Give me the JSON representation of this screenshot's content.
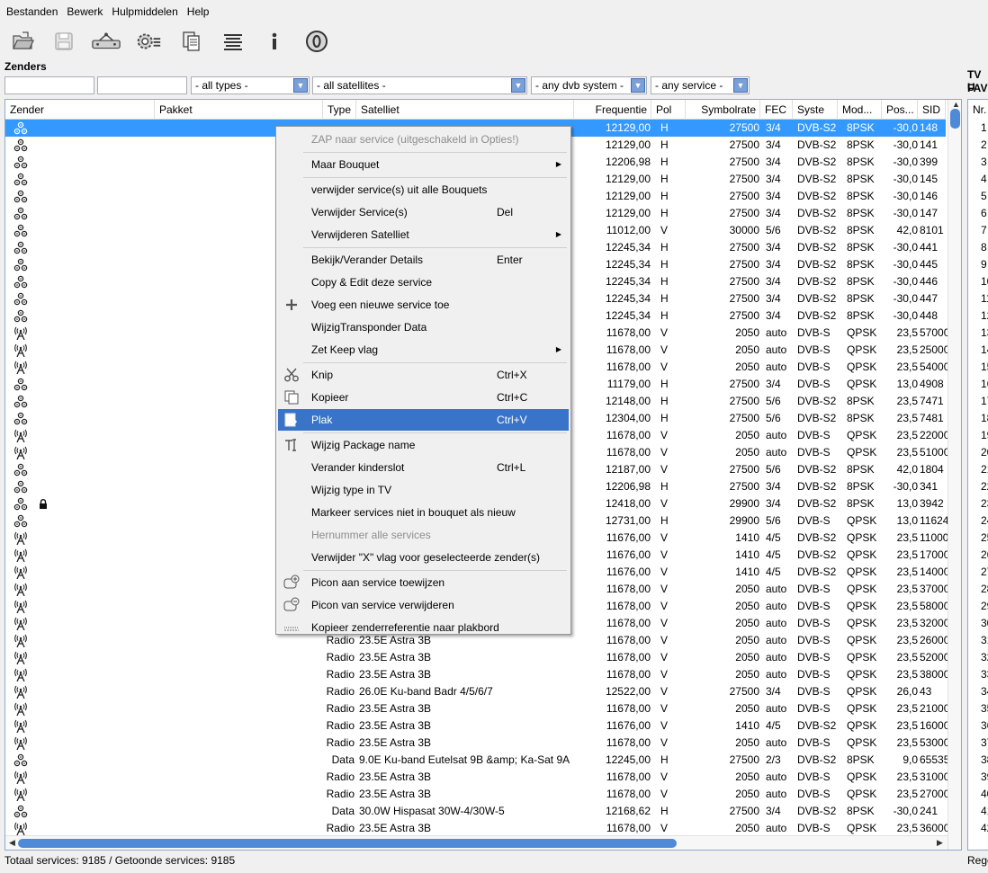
{
  "menubar": [
    "Bestanden",
    "Bewerk",
    "Hulpmiddelen",
    "Help"
  ],
  "toolbar_icons": [
    "open-folder-icon",
    "save-icon",
    "satellite-dish-icon",
    "settings-gear-icon",
    "copy-document-icon",
    "list-lines-icon",
    "info-icon",
    "zero-circle-icon"
  ],
  "section_title": "Zenders",
  "filters": {
    "types": "- all types -",
    "satellites": "- all satellites -",
    "dvb": "- any dvb system -",
    "service": "- any service -"
  },
  "side_labels": [
    "TV U",
    "FAVO"
  ],
  "columns": [
    "Zender",
    "Pakket",
    "Type",
    "Satelliet",
    "Frequentie",
    "Pol",
    "Symbolrate",
    "FEC",
    "Syste",
    "Mod...",
    "Pos...",
    "SID"
  ],
  "right_header": "Nr.",
  "rows": [
    {
      "icon": "tv",
      "type": "",
      "sat": "",
      "freq": "12129,00",
      "pol": "H",
      "sr": "27500",
      "fec": "3/4",
      "sys": "DVB-S2",
      "mod": "8PSK",
      "pos": "-30,0",
      "sid": "148",
      "sel": true
    },
    {
      "icon": "tv",
      "type": "",
      "sat": "",
      "freq": "12129,00",
      "pol": "H",
      "sr": "27500",
      "fec": "3/4",
      "sys": "DVB-S2",
      "mod": "8PSK",
      "pos": "-30,0",
      "sid": "141"
    },
    {
      "icon": "tv",
      "type": "",
      "sat": "",
      "freq": "12206,98",
      "pol": "H",
      "sr": "27500",
      "fec": "3/4",
      "sys": "DVB-S2",
      "mod": "8PSK",
      "pos": "-30,0",
      "sid": "399"
    },
    {
      "icon": "tv",
      "type": "",
      "sat": "",
      "freq": "12129,00",
      "pol": "H",
      "sr": "27500",
      "fec": "3/4",
      "sys": "DVB-S2",
      "mod": "8PSK",
      "pos": "-30,0",
      "sid": "145"
    },
    {
      "icon": "tv",
      "type": "",
      "sat": "",
      "freq": "12129,00",
      "pol": "H",
      "sr": "27500",
      "fec": "3/4",
      "sys": "DVB-S2",
      "mod": "8PSK",
      "pos": "-30,0",
      "sid": "146"
    },
    {
      "icon": "tv",
      "type": "",
      "sat": "",
      "freq": "12129,00",
      "pol": "H",
      "sr": "27500",
      "fec": "3/4",
      "sys": "DVB-S2",
      "mod": "8PSK",
      "pos": "-30,0",
      "sid": "147"
    },
    {
      "icon": "tv",
      "type": "",
      "sat": "",
      "freq": "11012,00",
      "pol": "V",
      "sr": "30000",
      "fec": "5/6",
      "sys": "DVB-S2",
      "mod": "8PSK",
      "pos": "42,0",
      "sid": "8101"
    },
    {
      "icon": "tv",
      "type": "",
      "sat": "",
      "freq": "12245,34",
      "pol": "H",
      "sr": "27500",
      "fec": "3/4",
      "sys": "DVB-S2",
      "mod": "8PSK",
      "pos": "-30,0",
      "sid": "441"
    },
    {
      "icon": "tv",
      "type": "",
      "sat": "",
      "freq": "12245,34",
      "pol": "H",
      "sr": "27500",
      "fec": "3/4",
      "sys": "DVB-S2",
      "mod": "8PSK",
      "pos": "-30,0",
      "sid": "445"
    },
    {
      "icon": "tv",
      "type": "",
      "sat": "",
      "freq": "12245,34",
      "pol": "H",
      "sr": "27500",
      "fec": "3/4",
      "sys": "DVB-S2",
      "mod": "8PSK",
      "pos": "-30,0",
      "sid": "446"
    },
    {
      "icon": "tv",
      "type": "",
      "sat": "",
      "freq": "12245,34",
      "pol": "H",
      "sr": "27500",
      "fec": "3/4",
      "sys": "DVB-S2",
      "mod": "8PSK",
      "pos": "-30,0",
      "sid": "447"
    },
    {
      "icon": "tv",
      "type": "",
      "sat": "",
      "freq": "12245,34",
      "pol": "H",
      "sr": "27500",
      "fec": "3/4",
      "sys": "DVB-S2",
      "mod": "8PSK",
      "pos": "-30,0",
      "sid": "448"
    },
    {
      "icon": "radio",
      "type": "",
      "sat": "",
      "freq": "11678,00",
      "pol": "V",
      "sr": "2050",
      "fec": "auto",
      "sys": "DVB-S",
      "mod": "QPSK",
      "pos": "23,5",
      "sid": "57000"
    },
    {
      "icon": "radio",
      "type": "",
      "sat": "",
      "freq": "11678,00",
      "pol": "V",
      "sr": "2050",
      "fec": "auto",
      "sys": "DVB-S",
      "mod": "QPSK",
      "pos": "23,5",
      "sid": "25000"
    },
    {
      "icon": "radio",
      "type": "",
      "sat": "",
      "freq": "11678,00",
      "pol": "V",
      "sr": "2050",
      "fec": "auto",
      "sys": "DVB-S",
      "mod": "QPSK",
      "pos": "23,5",
      "sid": "54000"
    },
    {
      "icon": "tv",
      "type": "",
      "sat": "",
      "freq": "11179,00",
      "pol": "H",
      "sr": "27500",
      "fec": "3/4",
      "sys": "DVB-S",
      "mod": "QPSK",
      "pos": "13,0",
      "sid": "4908"
    },
    {
      "icon": "tv",
      "type": "",
      "sat": "",
      "freq": "12148,00",
      "pol": "H",
      "sr": "27500",
      "fec": "5/6",
      "sys": "DVB-S2",
      "mod": "8PSK",
      "pos": "23,5",
      "sid": "7471"
    },
    {
      "icon": "tv",
      "type": "",
      "sat": "",
      "freq": "12304,00",
      "pol": "H",
      "sr": "27500",
      "fec": "5/6",
      "sys": "DVB-S2",
      "mod": "8PSK",
      "pos": "23,5",
      "sid": "7481"
    },
    {
      "icon": "radio",
      "type": "",
      "sat": "",
      "freq": "11678,00",
      "pol": "V",
      "sr": "2050",
      "fec": "auto",
      "sys": "DVB-S",
      "mod": "QPSK",
      "pos": "23,5",
      "sid": "22000"
    },
    {
      "icon": "radio",
      "type": "",
      "sat": "",
      "freq": "11678,00",
      "pol": "V",
      "sr": "2050",
      "fec": "auto",
      "sys": "DVB-S",
      "mod": "QPSK",
      "pos": "23,5",
      "sid": "51000"
    },
    {
      "icon": "tv",
      "type": "",
      "sat": "",
      "freq": "12187,00",
      "pol": "V",
      "sr": "27500",
      "fec": "5/6",
      "sys": "DVB-S2",
      "mod": "8PSK",
      "pos": "42,0",
      "sid": "1804"
    },
    {
      "icon": "tv",
      "type": "",
      "sat": "",
      "freq": "12206,98",
      "pol": "H",
      "sr": "27500",
      "fec": "3/4",
      "sys": "DVB-S2",
      "mod": "8PSK",
      "pos": "-30,0",
      "sid": "341"
    },
    {
      "icon": "tv",
      "lock": true,
      "type": "",
      "sat": "",
      "freq": "12418,00",
      "pol": "V",
      "sr": "29900",
      "fec": "3/4",
      "sys": "DVB-S2",
      "mod": "8PSK",
      "pos": "13,0",
      "sid": "3942"
    },
    {
      "icon": "tv",
      "type": "",
      "sat": "",
      "freq": "12731,00",
      "pol": "H",
      "sr": "29900",
      "fec": "5/6",
      "sys": "DVB-S",
      "mod": "QPSK",
      "pos": "13,0",
      "sid": "11624"
    },
    {
      "icon": "radio",
      "type": "",
      "sat": "",
      "freq": "11676,00",
      "pol": "V",
      "sr": "1410",
      "fec": "4/5",
      "sys": "DVB-S2",
      "mod": "QPSK",
      "pos": "23,5",
      "sid": "11000"
    },
    {
      "icon": "radio",
      "type": "",
      "sat": "",
      "freq": "11676,00",
      "pol": "V",
      "sr": "1410",
      "fec": "4/5",
      "sys": "DVB-S2",
      "mod": "QPSK",
      "pos": "23,5",
      "sid": "17000"
    },
    {
      "icon": "radio",
      "type": "",
      "sat": "",
      "freq": "11676,00",
      "pol": "V",
      "sr": "1410",
      "fec": "4/5",
      "sys": "DVB-S2",
      "mod": "QPSK",
      "pos": "23,5",
      "sid": "14000"
    },
    {
      "icon": "radio",
      "type": "",
      "sat": "",
      "freq": "11678,00",
      "pol": "V",
      "sr": "2050",
      "fec": "auto",
      "sys": "DVB-S",
      "mod": "QPSK",
      "pos": "23,5",
      "sid": "37000"
    },
    {
      "icon": "radio",
      "type": "",
      "sat": "",
      "freq": "11678,00",
      "pol": "V",
      "sr": "2050",
      "fec": "auto",
      "sys": "DVB-S",
      "mod": "QPSK",
      "pos": "23,5",
      "sid": "58000"
    },
    {
      "icon": "radio",
      "type": "",
      "sat": "",
      "freq": "11678,00",
      "pol": "V",
      "sr": "2050",
      "fec": "auto",
      "sys": "DVB-S",
      "mod": "QPSK",
      "pos": "23,5",
      "sid": "32000"
    },
    {
      "icon": "radio",
      "type": "Radio",
      "sat": "23.5E Astra 3B",
      "freq": "11678,00",
      "pol": "V",
      "sr": "2050",
      "fec": "auto",
      "sys": "DVB-S",
      "mod": "QPSK",
      "pos": "23,5",
      "sid": "26000"
    },
    {
      "icon": "radio",
      "type": "Radio",
      "sat": "23.5E Astra 3B",
      "freq": "11678,00",
      "pol": "V",
      "sr": "2050",
      "fec": "auto",
      "sys": "DVB-S",
      "mod": "QPSK",
      "pos": "23,5",
      "sid": "52000"
    },
    {
      "icon": "radio",
      "type": "Radio",
      "sat": "23.5E Astra 3B",
      "freq": "11678,00",
      "pol": "V",
      "sr": "2050",
      "fec": "auto",
      "sys": "DVB-S",
      "mod": "QPSK",
      "pos": "23,5",
      "sid": "38000"
    },
    {
      "icon": "radio",
      "type": "Radio",
      "sat": "26.0E Ku-band Badr 4/5/6/7",
      "freq": "12522,00",
      "pol": "V",
      "sr": "27500",
      "fec": "3/4",
      "sys": "DVB-S",
      "mod": "QPSK",
      "pos": "26,0",
      "sid": "43"
    },
    {
      "icon": "radio",
      "type": "Radio",
      "sat": "23.5E Astra 3B",
      "freq": "11678,00",
      "pol": "V",
      "sr": "2050",
      "fec": "auto",
      "sys": "DVB-S",
      "mod": "QPSK",
      "pos": "23,5",
      "sid": "21000"
    },
    {
      "icon": "radio",
      "type": "Radio",
      "sat": "23.5E Astra 3B",
      "freq": "11676,00",
      "pol": "V",
      "sr": "1410",
      "fec": "4/5",
      "sys": "DVB-S2",
      "mod": "QPSK",
      "pos": "23,5",
      "sid": "16000"
    },
    {
      "icon": "radio",
      "type": "Radio",
      "sat": "23.5E Astra 3B",
      "freq": "11678,00",
      "pol": "V",
      "sr": "2050",
      "fec": "auto",
      "sys": "DVB-S",
      "mod": "QPSK",
      "pos": "23,5",
      "sid": "53000"
    },
    {
      "icon": "tv",
      "type": "Data",
      "sat": "9.0E Ku-band Eutelsat 9B &amp; Ka-Sat 9A",
      "freq": "12245,00",
      "pol": "H",
      "sr": "27500",
      "fec": "2/3",
      "sys": "DVB-S2",
      "mod": "8PSK",
      "pos": "9,0",
      "sid": "65535"
    },
    {
      "icon": "radio",
      "type": "Radio",
      "sat": "23.5E Astra 3B",
      "freq": "11678,00",
      "pol": "V",
      "sr": "2050",
      "fec": "auto",
      "sys": "DVB-S",
      "mod": "QPSK",
      "pos": "23,5",
      "sid": "31000"
    },
    {
      "icon": "radio",
      "type": "Radio",
      "sat": "23.5E Astra 3B",
      "freq": "11678,00",
      "pol": "V",
      "sr": "2050",
      "fec": "auto",
      "sys": "DVB-S",
      "mod": "QPSK",
      "pos": "23,5",
      "sid": "27000"
    },
    {
      "icon": "tv",
      "type": "Data",
      "sat": "30.0W Hispasat 30W-4/30W-5",
      "freq": "12168,62",
      "pol": "H",
      "sr": "27500",
      "fec": "3/4",
      "sys": "DVB-S2",
      "mod": "8PSK",
      "pos": "-30,0",
      "sid": "241"
    },
    {
      "icon": "radio",
      "type": "Radio",
      "sat": "23.5E Astra 3B",
      "freq": "11678,00",
      "pol": "V",
      "sr": "2050",
      "fec": "auto",
      "sys": "DVB-S",
      "mod": "QPSK",
      "pos": "23,5",
      "sid": "36000"
    }
  ],
  "row_numbers": [
    "1",
    "2",
    "3",
    "4",
    "5",
    "6",
    "7",
    "8",
    "9",
    "10",
    "11",
    "12",
    "13",
    "14",
    "15",
    "16",
    "17",
    "18",
    "19",
    "20",
    "21",
    "22",
    "23",
    "24",
    "25",
    "26",
    "27",
    "28",
    "29",
    "30",
    "31",
    "32",
    "33",
    "34",
    "35",
    "36",
    "37",
    "38",
    "39",
    "40",
    "41",
    "42"
  ],
  "context_menu": [
    {
      "label": "ZAP naar service (uitgeschakeld in Opties!)",
      "disabled": true
    },
    {
      "sep": true
    },
    {
      "label": "Maar Bouquet",
      "submenu": true
    },
    {
      "sep": true
    },
    {
      "label": "verwijder service(s) uit alle Bouquets"
    },
    {
      "label": "Verwijder Service(s)",
      "shortcut": "Del"
    },
    {
      "label": "Verwijderen Satelliet",
      "submenu": true
    },
    {
      "sep": true
    },
    {
      "label": "Bekijk/Verander Details",
      "shortcut": "Enter"
    },
    {
      "label": "Copy & Edit deze service"
    },
    {
      "label": "Voeg een nieuwe service toe",
      "icon": "plus-icon"
    },
    {
      "label": "WijzigTransponder Data"
    },
    {
      "label": "Zet Keep vlag",
      "submenu": true
    },
    {
      "sep": true
    },
    {
      "label": "Knip",
      "shortcut": "Ctrl+X",
      "icon": "scissors-icon"
    },
    {
      "label": "Kopieer",
      "shortcut": "Ctrl+C",
      "icon": "copy-icon"
    },
    {
      "label": "Plak",
      "shortcut": "Ctrl+V",
      "icon": "paste-icon",
      "highlight": true
    },
    {
      "sep": true
    },
    {
      "label": "Wijzig Package name",
      "icon": "text-cursor-icon"
    },
    {
      "label": "Verander kinderslot",
      "shortcut": "Ctrl+L"
    },
    {
      "label": "Wijzig type in TV"
    },
    {
      "label": "Markeer services niet in bouquet als nieuw"
    },
    {
      "label": "Hernummer alle services",
      "disabled": true
    },
    {
      "label": "Verwijder \"X\" vlag voor geselecteerde zender(s)"
    },
    {
      "sep": true
    },
    {
      "label": "Picon aan service toewijzen",
      "icon": "picon-add-icon"
    },
    {
      "label": "Picon van service verwijderen",
      "icon": "picon-remove-icon"
    },
    {
      "label": "Kopieer zenderreferentie naar plakbord",
      "icon": "reference-icon"
    }
  ],
  "status": {
    "left": "Totaal services: 9185  /  Getoonde services: 9185",
    "right": "Rege"
  }
}
